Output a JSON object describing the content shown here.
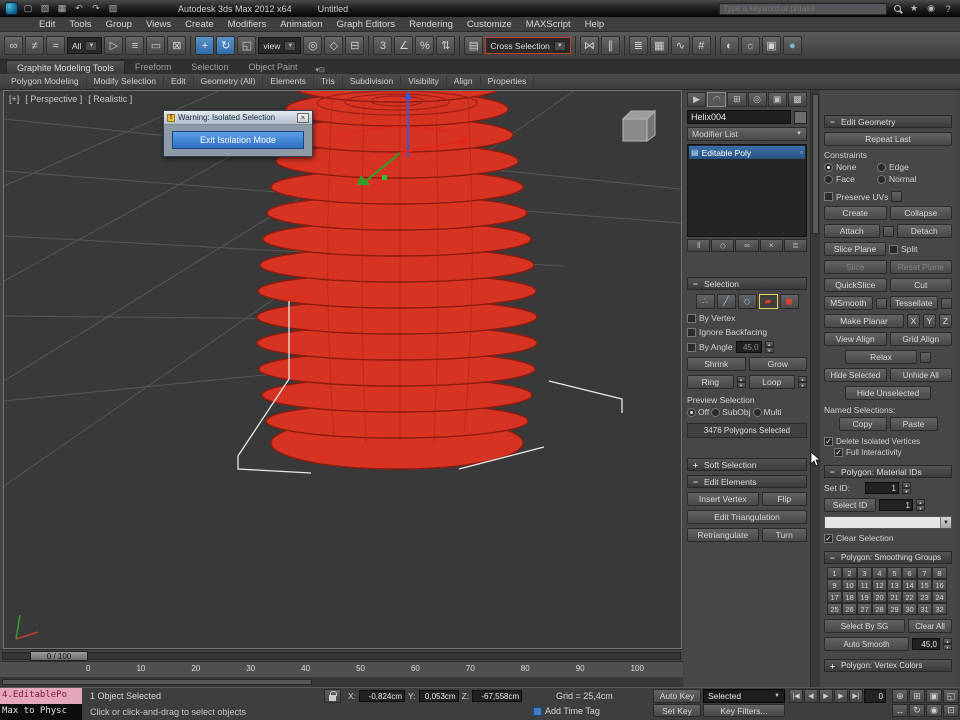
{
  "colors": {
    "object_red": "#d63323",
    "selection_blue": "#2f5e8f",
    "dialog_button_blue": "#3f82d2",
    "subobject_highlight_yellow": "#e8d44a",
    "macro_recorder_pink": "#e3a8bb"
  },
  "titlebar": {
    "app_title": "Autodesk 3ds Max 2012 x64",
    "doc_title": "Untitled",
    "search_placeholder": "Type a keyword or phrase"
  },
  "menubar": [
    "Edit",
    "Tools",
    "Group",
    "Views",
    "Create",
    "Modifiers",
    "Animation",
    "Graph Editors",
    "Rendering",
    "Customize",
    "MAXScript",
    "Help"
  ],
  "toolbar": {
    "selection_filter": "All",
    "coord_system": "view",
    "named_selection_set": "Cross Selection",
    "snap_label": "3"
  },
  "ribbon": {
    "tabs": [
      "Graphite Modeling Tools",
      "Freeform",
      "Selection",
      "Object Paint"
    ],
    "subtabs": [
      "Polygon Modeling",
      "Modify Selection",
      "Edit",
      "Geometry (All)",
      "Elements",
      "Tris",
      "Subdivision",
      "Visibility",
      "Align",
      "Properties"
    ]
  },
  "viewport": {
    "label_plus": "[+]",
    "label_view": "[ Perspective ]",
    "label_shading": "[ Realistic ]"
  },
  "dialog": {
    "title": "Warning: Isolated Selection",
    "close": "×",
    "button": "Exit Isolation Mode"
  },
  "command_panel": {
    "object_name": "Helix004",
    "modifier_list": "Modifier List",
    "stack_item": "Editable Poly",
    "selection": {
      "title": "Selection",
      "by_vertex": "By Vertex",
      "ignore_backfacing": "Ignore Backfacing",
      "by_angle": "By Angle",
      "by_angle_value": "45,0",
      "shrink": "Shrink",
      "grow": "Grow",
      "ring": "Ring",
      "loop": "Loop",
      "preview_label": "Preview Selection",
      "preview_off": "Off",
      "preview_subobj": "SubObj",
      "preview_multi": "Multi",
      "status": "3476 Polygons Selected"
    },
    "soft_selection_title": "Soft Selection",
    "edit_elements": {
      "title": "Edit Elements",
      "insert_vertex": "Insert Vertex",
      "flip": "Flip",
      "edit_triangulation": "Edit Triangulation",
      "retriangulate": "Retriangulate",
      "turn": "Turn"
    }
  },
  "edit_geometry": {
    "title": "Edit Geometry",
    "repeat_last": "Repeat Last",
    "constraints_label": "Constraints",
    "constraint_none": "None",
    "constraint_edge": "Edge",
    "constraint_face": "Face",
    "constraint_normal": "Normal",
    "preserve_uvs": "Preserve UVs",
    "create": "Create",
    "collapse": "Collapse",
    "attach": "Attach",
    "detach": "Detach",
    "slice_plane": "Slice Plane",
    "split": "Split",
    "slice": "Slice",
    "reset_plane": "Reset Plane",
    "quickslice": "QuickSlice",
    "cut": "Cut",
    "msmooth": "MSmooth",
    "tessellate": "Tessellate",
    "make_planar": "Make Planar",
    "x": "X",
    "y": "Y",
    "z": "Z",
    "view_align": "View Align",
    "grid_align": "Grid Align",
    "relax": "Relax",
    "hide_selected": "Hide Selected",
    "unhide_all": "Unhide All",
    "hide_unselected": "Hide Unselected",
    "named_selections": "Named Selections:",
    "copy": "Copy",
    "paste": "Paste",
    "delete_isolated": "Delete Isolated Vertices",
    "full_interactivity": "Full Interactivity"
  },
  "material_ids": {
    "title": "Polygon: Material IDs",
    "set_id": "Set ID:",
    "set_id_value": "1",
    "select_id": "Select ID",
    "select_id_value": "1",
    "clear_selection": "Clear Selection"
  },
  "smoothing": {
    "title": "Polygon: Smoothing Groups",
    "numbers": [
      "1",
      "2",
      "3",
      "4",
      "5",
      "6",
      "7",
      "8",
      "9",
      "10",
      "11",
      "12",
      "13",
      "14",
      "15",
      "16",
      "17",
      "18",
      "19",
      "20",
      "21",
      "22",
      "23",
      "24",
      "25",
      "26",
      "27",
      "28",
      "29",
      "30",
      "31",
      "32"
    ],
    "select_by_sg": "Select By SG",
    "clear_all": "Clear All",
    "auto_smooth": "Auto Smooth",
    "auto_smooth_value": "45,0"
  },
  "vertex_colors_title": "Polygon: Vertex Colors",
  "timeline": {
    "slider_label": "0 / 100",
    "ticks": [
      "0",
      "10",
      "20",
      "30",
      "40",
      "50",
      "60",
      "70",
      "80",
      "90",
      "100"
    ]
  },
  "statusbar": {
    "listener_line1": "4.EditablePo",
    "listener_line2": "Max to Physc",
    "status": "1 Object Selected",
    "x_label": "X:",
    "x_value": "-0,824cm",
    "y_label": "Y:",
    "y_value": "0,053cm",
    "z_label": "Z:",
    "z_value": "-67,558cm",
    "grid": "Grid = 25,4cm",
    "prompt": "Click or click-and-drag to select objects",
    "add_time_tag": "Add Time Tag",
    "auto_key": "Auto Key",
    "set_key": "Set Key",
    "selected_mode": "Selected",
    "key_filters": "Key Filters...",
    "time_value": "0"
  }
}
